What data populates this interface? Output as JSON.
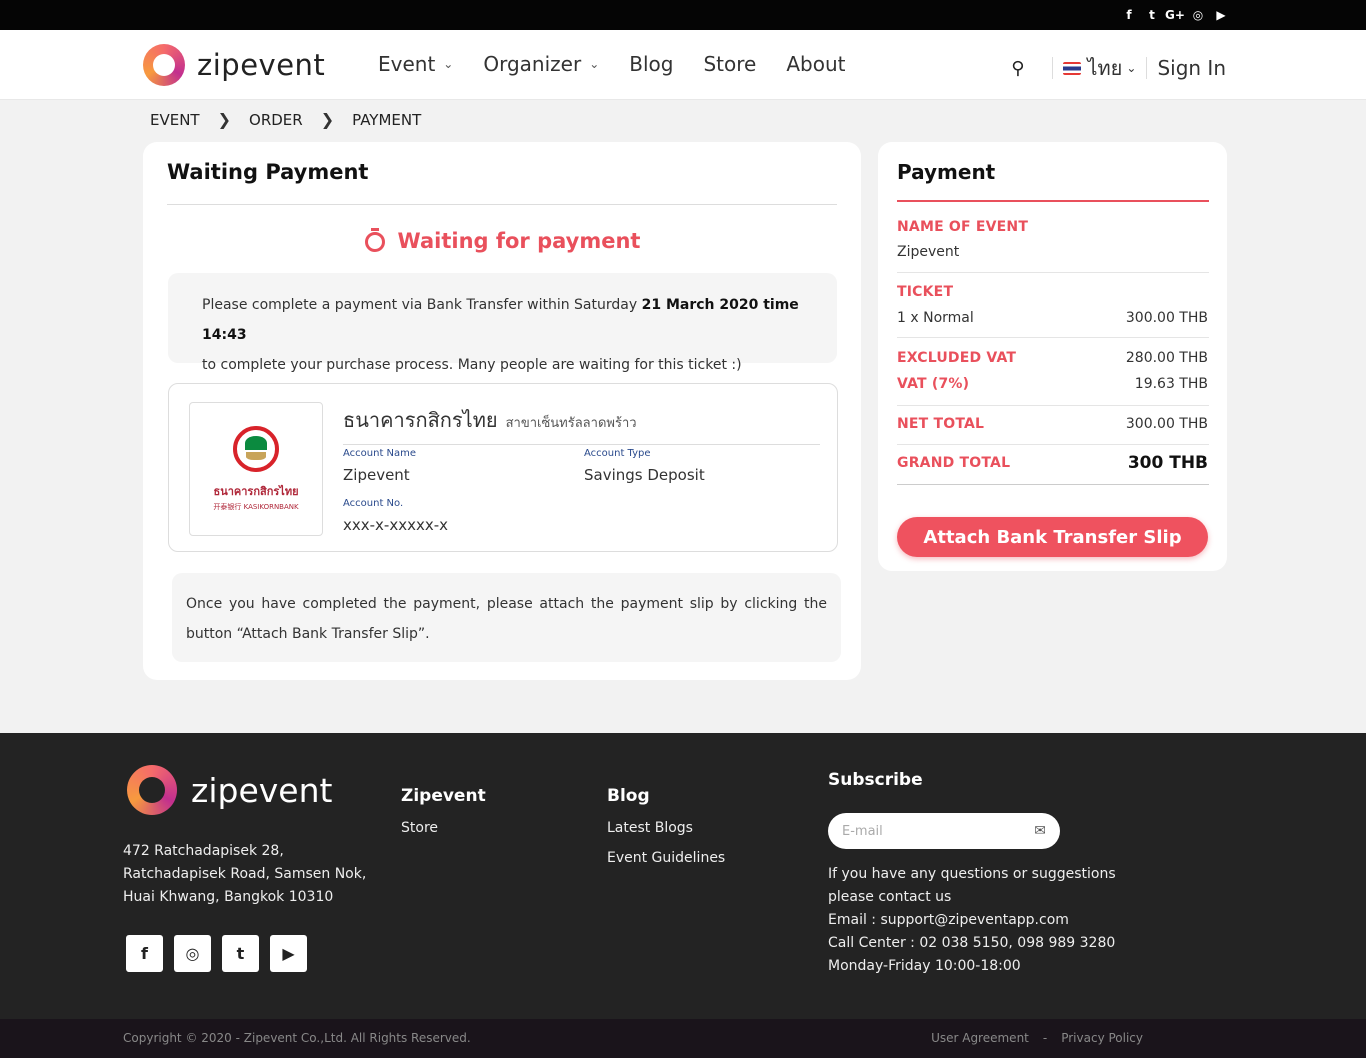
{
  "topbar": {
    "social_icons": [
      "facebook-icon",
      "twitter-icon",
      "google-plus-icon",
      "instagram-icon",
      "youtube-icon"
    ],
    "glyphs": [
      "f",
      "t",
      "G+",
      "◎",
      "▶"
    ]
  },
  "header": {
    "logo_text": "zipevent",
    "nav": [
      {
        "label": "Event",
        "has_dropdown": true
      },
      {
        "label": "Organizer",
        "has_dropdown": true
      },
      {
        "label": "Blog",
        "has_dropdown": false
      },
      {
        "label": "Store",
        "has_dropdown": false
      },
      {
        "label": "About",
        "has_dropdown": false
      }
    ],
    "language": "ไทย",
    "sign_in": "Sign In"
  },
  "breadcrumb": [
    "EVENT",
    "ORDER",
    "PAYMENT"
  ],
  "main": {
    "title": "Waiting Payment",
    "status": "Waiting for payment",
    "notice_pre": "Please complete a payment via Bank Transfer within Saturday ",
    "notice_deadline": "21 March 2020 time 14:43",
    "notice_post": "to complete your purchase process. Many people are waiting for this ticket :)",
    "bank": {
      "logo_thai": "ธนาคารกสิกรไทย",
      "logo_en": "开泰银行 KASIKORNBANK",
      "name": "ธนาคารกสิกรไทย",
      "branch": "สาขาเซ็นทรัลลาดพร้าว",
      "account_name_label": "Account Name",
      "account_name": "Zipevent",
      "account_type_label": "Account Type",
      "account_type": "Savings Deposit",
      "account_no_label": "Account No.",
      "account_no": "xxx-x-xxxxx-x"
    },
    "instruction": "Once you have completed the payment, please attach the payment slip by clicking the button  “Attach Bank Transfer Slip”."
  },
  "payment": {
    "title": "Payment",
    "name_of_event_label": "NAME OF EVENT",
    "name_of_event": "Zipevent",
    "ticket_label": "TICKET",
    "ticket_item": "1 x Normal",
    "ticket_price": "300.00 THB",
    "excluded_vat_label": "EXCLUDED VAT",
    "excluded_vat": "280.00 THB",
    "vat_label": "VAT (7%)",
    "vat": "19.63 THB",
    "net_total_label": "NET TOTAL",
    "net_total": "300.00 THB",
    "grand_total_label": "GRAND TOTAL",
    "grand_total": "300 THB",
    "attach_button": "Attach Bank Transfer Slip"
  },
  "footer": {
    "logo_text": "zipevent",
    "address_lines": [
      "472 Ratchadapisek 28,",
      "Ratchadapisek Road, Samsen Nok,",
      "Huai Khwang, Bangkok 10310"
    ],
    "social_glyphs": [
      "f",
      "◎",
      "t",
      "▶"
    ],
    "col1_title": "Zipevent",
    "col1_links": [
      "Store"
    ],
    "col2_title": "Blog",
    "col2_links": [
      "Latest Blogs",
      "Event Guidelines"
    ],
    "subscribe_title": "Subscribe",
    "email_placeholder": "E-mail",
    "contact_lines": [
      "If you have any questions or suggestions please contact us",
      "Email : support@zipeventapp.com",
      "Call Center : 02 038 5150, 098 989 3280",
      "Monday-Friday 10:00-18:00"
    ],
    "copyright": "Copyright © 2020 - Zipevent Co.,Ltd. All Rights Reserved.",
    "user_agreement": "User Agreement",
    "link_sep": "-",
    "privacy_policy": "Privacy Policy"
  },
  "colors": {
    "accent": "#e9505c",
    "button": "#ef525f",
    "footer_bg": "#232323"
  }
}
